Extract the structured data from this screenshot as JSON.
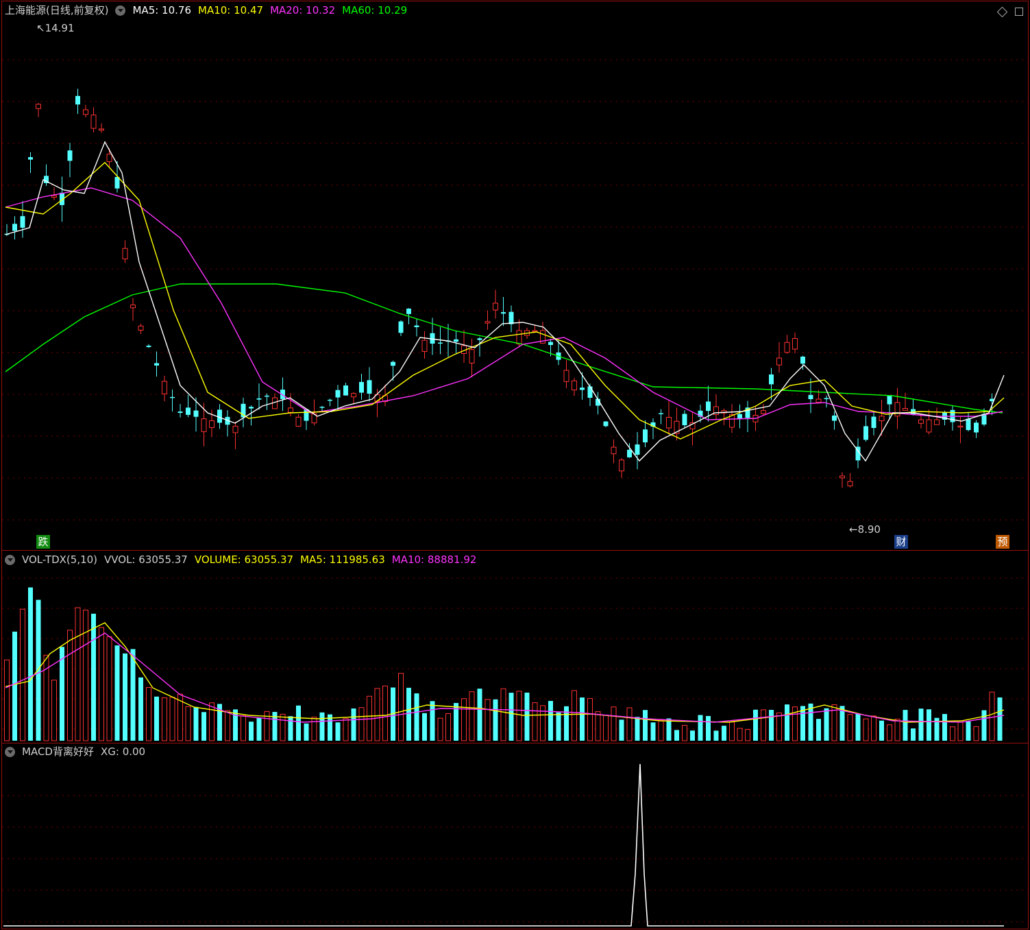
{
  "price_panel": {
    "title": "上海能源(日线,前复权)",
    "ma": [
      {
        "label": "MA5: 10.76",
        "color": "#ffffff"
      },
      {
        "label": "MA10: 10.47",
        "color": "#ffff00"
      },
      {
        "label": "MA20: 10.32",
        "color": "#ff33ff"
      },
      {
        "label": "MA60: 10.29",
        "color": "#00ff00"
      }
    ],
    "high_label": "14.91",
    "low_label": "8.90",
    "badges": {
      "left": "跌",
      "mid": "财",
      "right": "预"
    }
  },
  "volume_panel": {
    "title": "VOL-TDX(5,10)",
    "vvol": "VVOL: 63055.37",
    "volume": "VOLUME: 63055.37",
    "ma5": "MA5: 111985.63",
    "ma10": "MA10: 88881.92"
  },
  "macd_panel": {
    "title": "MACD背离好好",
    "xg": "XG: 0.00"
  },
  "colors": {
    "up": "#ff3232",
    "down": "#54ffff",
    "ma5": "#ffffff",
    "ma10": "#ffff00",
    "ma20": "#ff33ff",
    "ma60": "#00ff00",
    "grid": "#7a0000",
    "border": "#9a1010"
  }
}
